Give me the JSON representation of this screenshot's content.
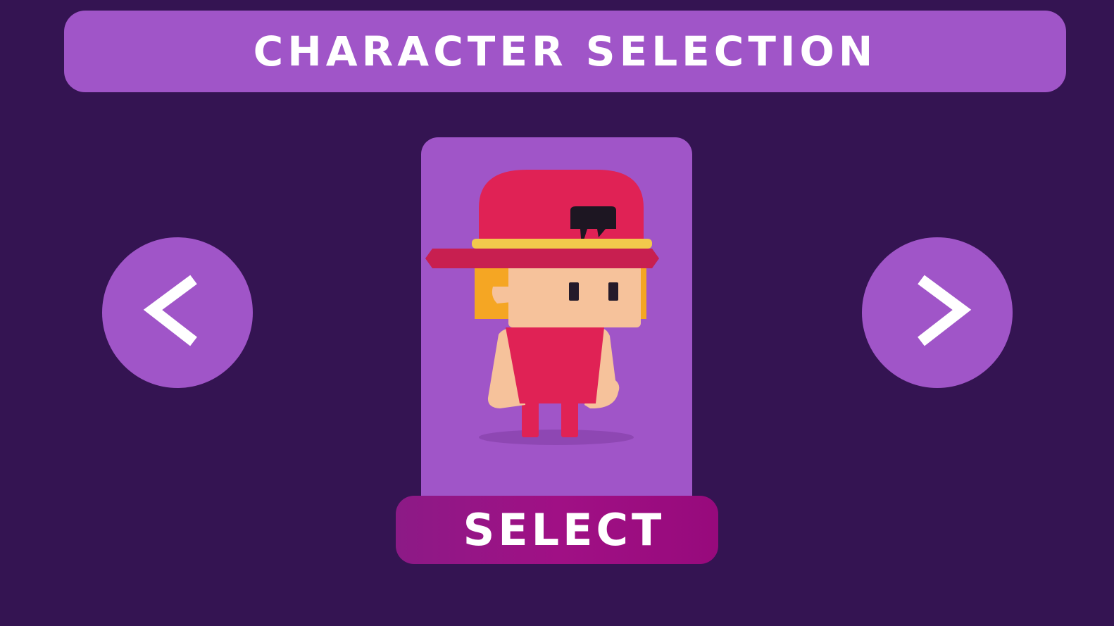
{
  "screen": {
    "title": "CHARACTER SELECTION",
    "select_label": "SELECT"
  },
  "colors": {
    "background": "#341452",
    "panel": "#a055c8",
    "select_button": "#9a0f82",
    "text": "#ffffff",
    "hat": "#e02255",
    "hat_band": "#f2c94c",
    "hair": "#f5a623",
    "skin": "#f6c29b"
  },
  "icons": {
    "prev": "chevron-left-icon",
    "next": "chevron-right-icon"
  }
}
